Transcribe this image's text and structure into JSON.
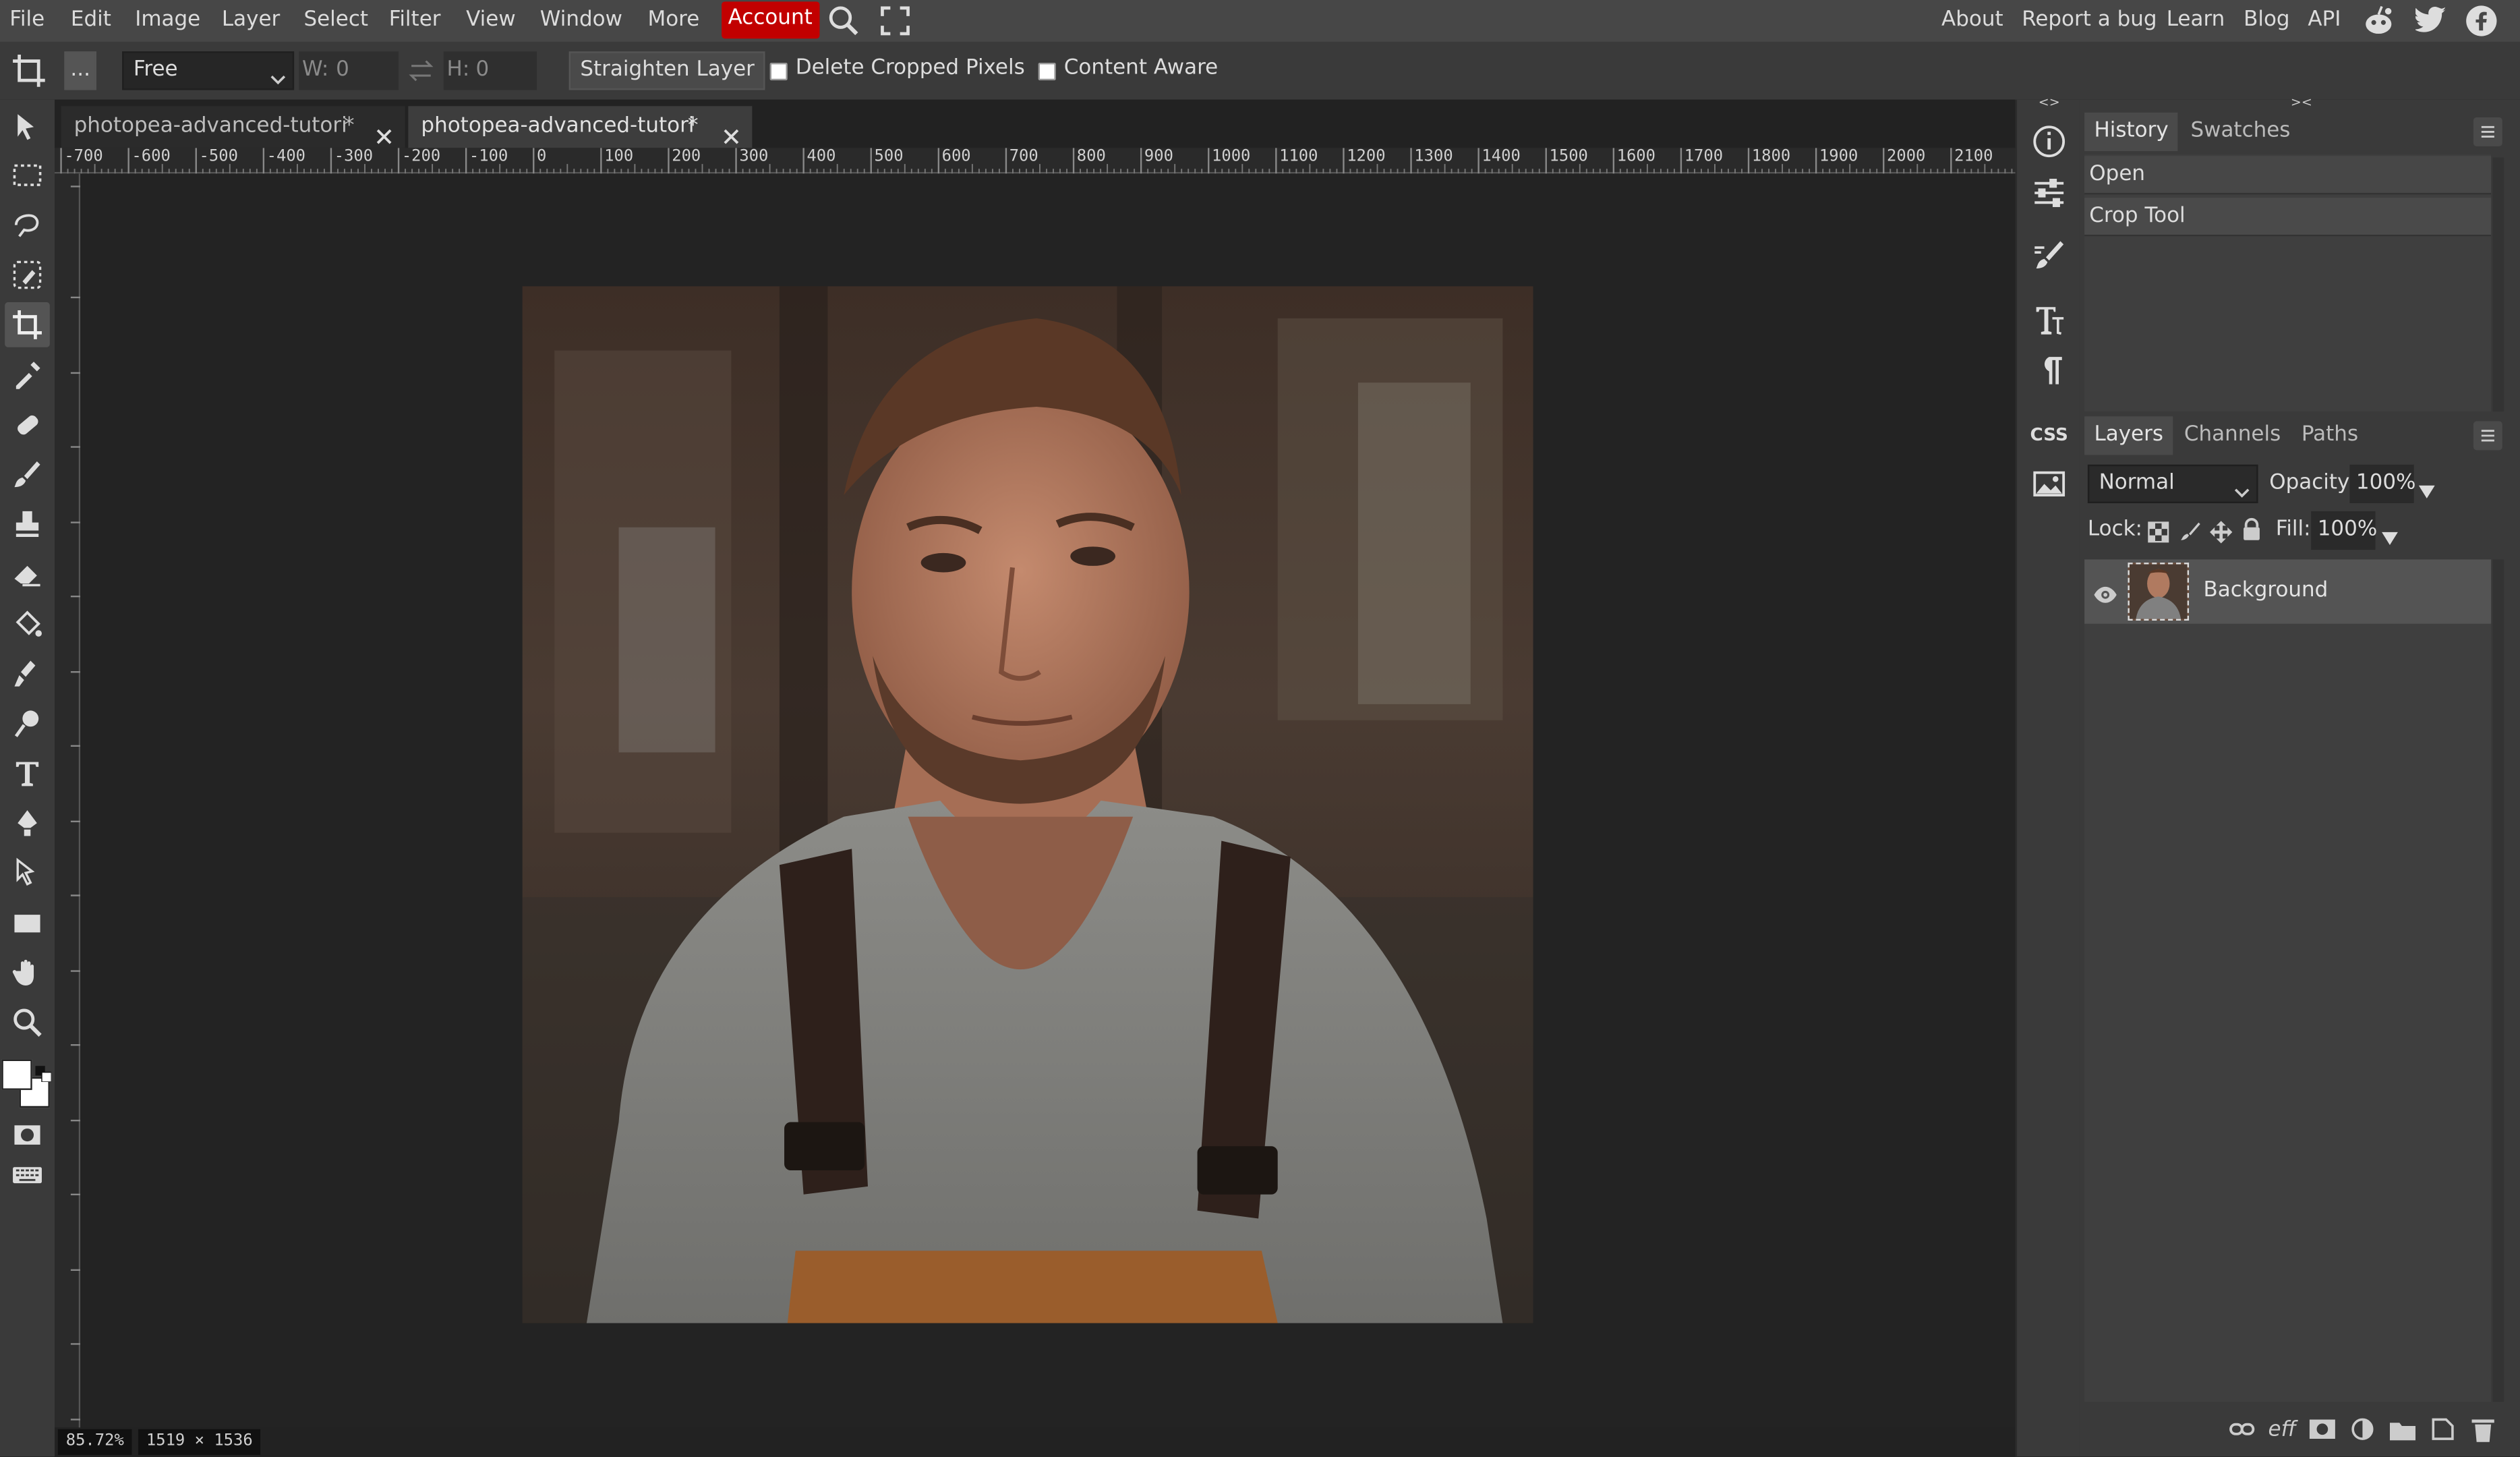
{
  "menu": {
    "items": [
      "File",
      "Edit",
      "Image",
      "Layer",
      "Select",
      "Filter",
      "View",
      "Window",
      "More"
    ],
    "account": "Account",
    "right_links": [
      "About",
      "Report a bug",
      "Learn",
      "Blog",
      "API"
    ]
  },
  "options": {
    "more_button": "...",
    "ratio_mode": "Free",
    "w_label": "W:",
    "w_value": "0",
    "h_label": "H:",
    "h_value": "0",
    "straighten": "Straighten Layer",
    "delete_cropped": "Delete Cropped Pixels",
    "content_aware": "Content Aware"
  },
  "tabs": [
    {
      "title": "photopea-advanced-tutori",
      "modified": "*"
    },
    {
      "title": "photopea-advanced-tutori",
      "modified": "*"
    }
  ],
  "ruler": {
    "top_labels": [
      "-700",
      "-600",
      "-500",
      "-400",
      "-300",
      "-200",
      "-100",
      "0",
      "100",
      "200",
      "300",
      "400",
      "500",
      "600",
      "700",
      "800",
      "900",
      "1000",
      "1100",
      "1200",
      "1300",
      "1400",
      "1500",
      "1600",
      "1700",
      "1800",
      "1900",
      "2000",
      "2100"
    ]
  },
  "status": {
    "zoom": "85.72%",
    "dimensions": "1519 × 1536"
  },
  "history_panel": {
    "tabs": [
      "History",
      "Swatches"
    ],
    "entries": [
      "Open",
      "Crop Tool"
    ]
  },
  "layers_panel": {
    "tabs": [
      "Layers",
      "Channels",
      "Paths"
    ],
    "blend_mode": "Normal",
    "opacity_label": "Opacity:",
    "opacity_value": "100%",
    "lock_label": "Lock:",
    "fill_label": "Fill:",
    "fill_value": "100%",
    "layers": [
      {
        "name": "Background"
      }
    ],
    "bottom_icons": [
      "link-icon",
      "effects-icon",
      "mask-icon",
      "adjustment-icon",
      "folder-icon",
      "new-layer-icon",
      "trash-icon"
    ],
    "eff_label": "eff"
  },
  "sidestrip": {
    "css_label": "CSS"
  },
  "colors": {
    "accent": "#c20000",
    "menubar": "#474747",
    "panel": "#3a3a3a",
    "canvas": "#232323"
  }
}
